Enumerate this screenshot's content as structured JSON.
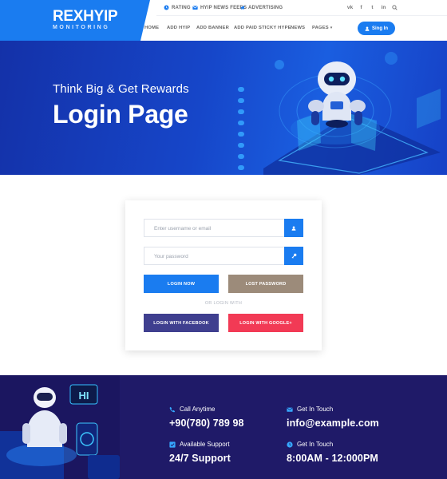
{
  "colors": {
    "accent": "#1a7cf0",
    "lost_password": "#9c8b7a",
    "facebook": "#3f3f8f",
    "google": "#f23a55",
    "footer": "#1f1a68"
  },
  "brand": {
    "name": "REXHYIP",
    "sub": "MONITORING"
  },
  "topbar": {
    "links": [
      {
        "icon": "clock-icon",
        "label": "RATING"
      },
      {
        "icon": "mail-icon",
        "label": "HYIP NEWS FEEDS"
      },
      {
        "icon": "megaphone-icon",
        "label": "ADVERTISING"
      }
    ],
    "socials": [
      "vk-icon",
      "facebook-icon",
      "twitter-icon",
      "linkedin-icon",
      "search-icon"
    ]
  },
  "nav": {
    "items": [
      "HOME",
      "ADD HYIP",
      "ADD BANNER",
      "ADD PAID STICKY HYPE",
      "NEWS",
      "PAGES"
    ],
    "signin": "Sing In"
  },
  "hero": {
    "tagline": "Think Big & Get Rewards",
    "title": "Login Page"
  },
  "login": {
    "username_placeholder": "Enter username or email",
    "password_placeholder": "Your password",
    "login_button": "LOGIN NOW",
    "lost_password": "LOST PASSWORD",
    "or_text": "OR LOGIN WITH",
    "facebook_button": "LOGIN WITH FACEBOOK",
    "google_button": "LOGIN WITH GOOGLE+"
  },
  "footer": {
    "art_text": "HI",
    "contacts": [
      {
        "icon": "phone-icon",
        "label": "Call Anytime",
        "value": "+90(780) 789 98"
      },
      {
        "icon": "envelope-icon",
        "label": "Get In Touch",
        "value": "info@example.com"
      },
      {
        "icon": "checkbox-icon",
        "label": "Available Support",
        "value": "24/7 Support"
      },
      {
        "icon": "clock-icon",
        "label": "Get In Touch",
        "value": "8:00AM - 12:000PM"
      }
    ]
  }
}
